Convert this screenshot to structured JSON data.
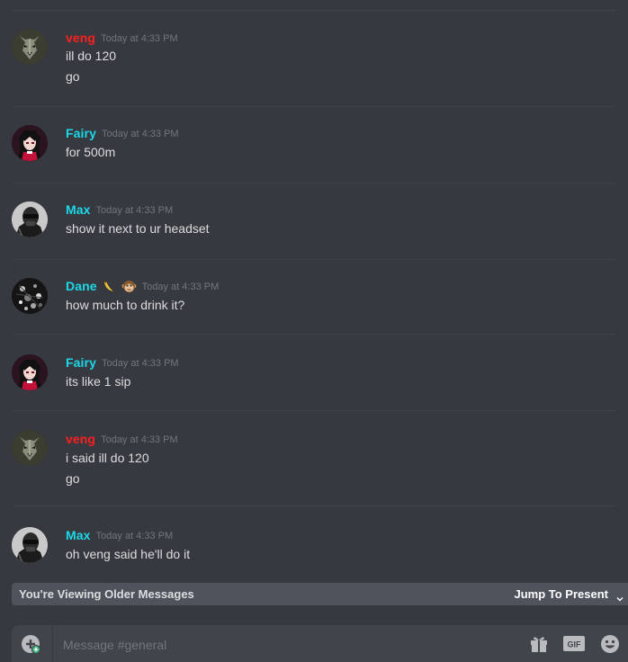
{
  "channel": "general",
  "colors": {
    "background": "#36393f",
    "veng": "#ff1f1f",
    "cyan_user": "#1cd8e8",
    "timestamp": "#72767d",
    "message_text": "#dcddde",
    "older_bar": "#4f545c",
    "input_bg": "#40444b"
  },
  "messages": [
    {
      "username": "veng",
      "timestamp": "Today at 4:33 PM",
      "avatar": "wolf-avatar",
      "lines": [
        "ill do 120",
        "go"
      ]
    },
    {
      "username": "Fairy",
      "timestamp": "Today at 4:33 PM",
      "avatar": "anime-girl-avatar",
      "lines": [
        "for 500m"
      ]
    },
    {
      "username": "Max",
      "timestamp": "Today at 4:33 PM",
      "avatar": "masked-man-avatar",
      "lines": [
        "show it next to ur headset"
      ]
    },
    {
      "username": "Dane",
      "username_emojis": [
        "banana-emoji",
        "monkey-emoji"
      ],
      "timestamp": "Today at 4:33 PM",
      "avatar": "dark-pattern-avatar",
      "lines": [
        "how much to drink it?"
      ]
    },
    {
      "username": "Fairy",
      "timestamp": "Today at 4:33 PM",
      "avatar": "anime-girl-avatar",
      "lines": [
        "its like 1 sip"
      ]
    },
    {
      "username": "veng",
      "timestamp": "Today at 4:33 PM",
      "avatar": "wolf-avatar",
      "lines": [
        "i said ill do 120",
        "go"
      ]
    },
    {
      "username": "Max",
      "timestamp": "Today at 4:33 PM",
      "avatar": "masked-man-avatar",
      "lines": [
        "oh veng said he'll do it"
      ]
    }
  ],
  "older_bar": {
    "label": "You're Viewing Older Messages",
    "jump_label": "Jump To Present"
  },
  "composer": {
    "placeholder": "Message #general",
    "icons": [
      "attach-plus-icon",
      "gift-icon",
      "gif-icon",
      "emoji-smile-icon"
    ]
  }
}
